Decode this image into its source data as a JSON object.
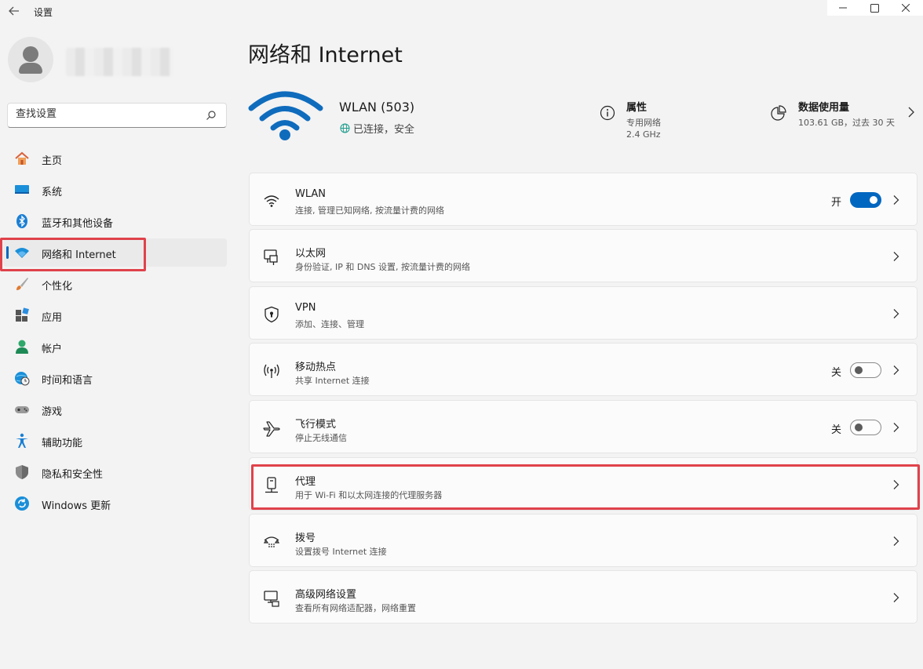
{
  "window": {
    "title": "设置",
    "back_icon": "arrow-left-icon",
    "controls": [
      "minimize-icon",
      "maximize-icon",
      "close-icon"
    ]
  },
  "sidebar": {
    "search": {
      "placeholder": "查找设置",
      "icon": "search-icon"
    },
    "items": [
      {
        "label": "主页",
        "icon": "home-icon"
      },
      {
        "label": "系统",
        "icon": "monitor-icon"
      },
      {
        "label": "蓝牙和其他设备",
        "icon": "bluetooth-icon"
      },
      {
        "label": "网络和 Internet",
        "icon": "wifi-icon",
        "active": true
      },
      {
        "label": "个性化",
        "icon": "brush-icon"
      },
      {
        "label": "应用",
        "icon": "apps-icon"
      },
      {
        "label": "帐户",
        "icon": "person-icon"
      },
      {
        "label": "时间和语言",
        "icon": "globe-clock-icon"
      },
      {
        "label": "游戏",
        "icon": "gamepad-icon"
      },
      {
        "label": "辅助功能",
        "icon": "accessibility-icon"
      },
      {
        "label": "隐私和安全性",
        "icon": "shield-icon"
      },
      {
        "label": "Windows 更新",
        "icon": "refresh-icon"
      }
    ]
  },
  "main": {
    "title": "网络和 Internet",
    "header": {
      "network_name": "WLAN (503)",
      "status": "已连接，安全",
      "properties": {
        "title": "属性",
        "line1": "专用网络",
        "line2": "2.4 GHz"
      },
      "usage": {
        "title": "数据使用量",
        "line1": "103.61 GB，过去 30 天"
      }
    },
    "cards": [
      {
        "title": "WLAN",
        "subtitle": "连接, 管理已知网络, 按流量计费的网络",
        "icon": "wifi-icon",
        "toggle_label": "开",
        "toggle_on": true
      },
      {
        "title": "以太网",
        "subtitle": "身份验证, IP 和 DNS 设置, 按流量计费的网络",
        "icon": "ethernet-icon"
      },
      {
        "title": "VPN",
        "subtitle": "添加、连接、管理",
        "icon": "vpn-shield-icon"
      },
      {
        "title": "移动热点",
        "subtitle": "共享 Internet 连接",
        "icon": "hotspot-icon",
        "toggle_label": "关",
        "toggle_on": false
      },
      {
        "title": "飞行模式",
        "subtitle": "停止无线通信",
        "icon": "airplane-icon",
        "toggle_label": "关",
        "toggle_on": false
      },
      {
        "title": "代理",
        "subtitle": "用于 Wi-Fi 和以太网连接的代理服务器",
        "icon": "proxy-icon"
      },
      {
        "title": "拨号",
        "subtitle": "设置拨号 Internet 连接",
        "icon": "dialup-icon"
      },
      {
        "title": "高级网络设置",
        "subtitle": "查看所有网络适配器，网络重置",
        "icon": "network-pc-icon"
      }
    ]
  },
  "colors": {
    "accent": "#0067c0",
    "highlight_box": "#e0424b",
    "wifi_blue": "#0f6cbd"
  }
}
